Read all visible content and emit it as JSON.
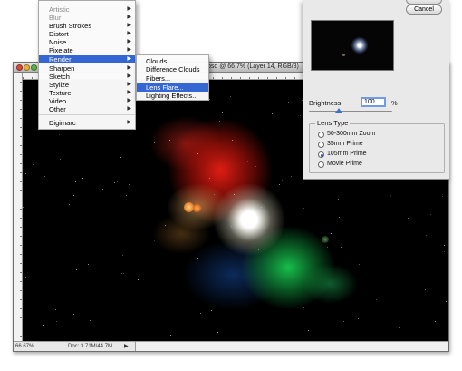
{
  "document": {
    "title": "psd @ 66.7% (Layer 14, RGB/8)",
    "zoom": "66.67%",
    "doc_size": "Doc: 3.71M/44.7M"
  },
  "filter_menu": {
    "items": [
      {
        "label": "Artistic",
        "submenu": true
      },
      {
        "label": "Blur",
        "submenu": true
      },
      {
        "label": "Brush Strokes",
        "submenu": true
      },
      {
        "label": "Distort",
        "submenu": true
      },
      {
        "label": "Noise",
        "submenu": true
      },
      {
        "label": "Pixelate",
        "submenu": true
      },
      {
        "label": "Render",
        "submenu": true
      },
      {
        "label": "Sharpen",
        "submenu": true
      },
      {
        "label": "Sketch",
        "submenu": true
      },
      {
        "label": "Stylize",
        "submenu": true
      },
      {
        "label": "Texture",
        "submenu": true
      },
      {
        "label": "Video",
        "submenu": true
      },
      {
        "label": "Other",
        "submenu": true
      },
      {
        "label": "Digimarc",
        "submenu": true
      }
    ],
    "selected": "Render"
  },
  "render_submenu": {
    "items": [
      "Clouds",
      "Difference Clouds",
      "Fibers...",
      "Lens Flare...",
      "Lighting Effects..."
    ],
    "selected": "Lens Flare..."
  },
  "lens_flare_dialog": {
    "cancel_label": "Cancel",
    "brightness_label": "Brightness:",
    "brightness_value": "100",
    "brightness_unit": "%",
    "brightness_slider_level": 100,
    "lens_type_label": "Lens Type",
    "lens_types": [
      "50-300mm Zoom",
      "35mm Prime",
      "105mm Prime",
      "Movie Prime"
    ],
    "selected_lens": "105mm Prime"
  },
  "colors": {
    "menu_highlight": "#3467d3",
    "dialog_background": "#e9e9e9",
    "canvas_background": "#000000"
  }
}
